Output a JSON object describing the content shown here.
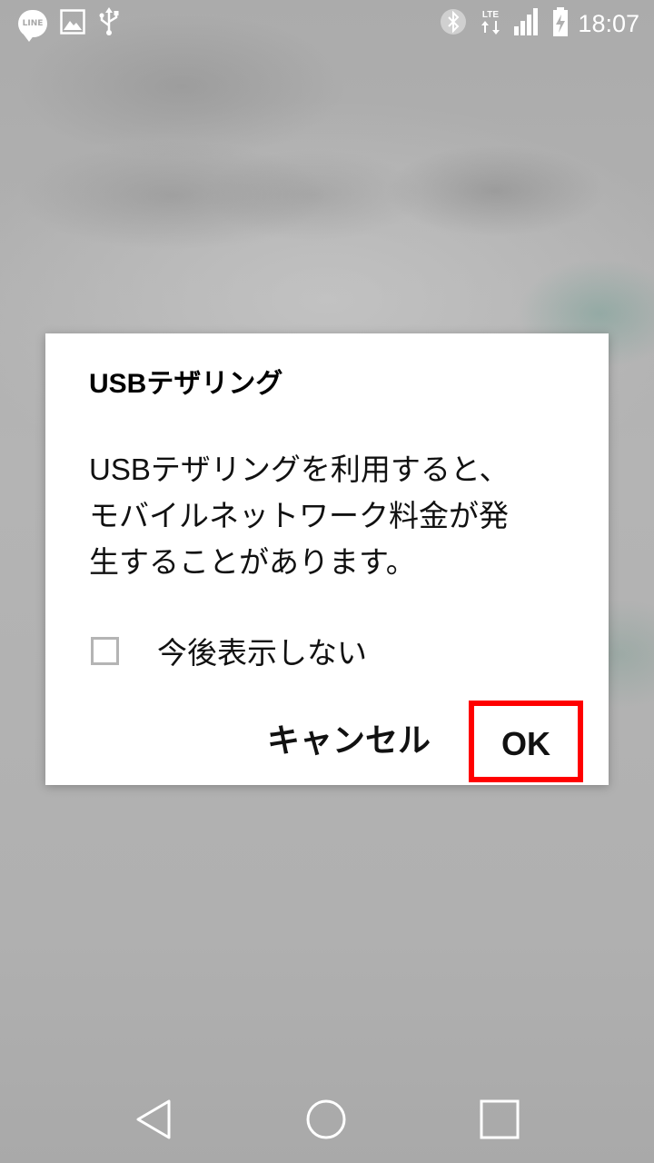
{
  "status_bar": {
    "icons": [
      "line-app-icon",
      "gallery-icon",
      "usb-icon",
      "bluetooth-icon",
      "lte-icon",
      "signal-icon",
      "battery-charging-icon"
    ],
    "line_label": "LINE",
    "lte_label": "LTE",
    "time": "18:07"
  },
  "dialog": {
    "title": "USBテザリング",
    "message_lines": [
      "USBテザリングを利用すると、",
      "モバイルネットワーク料金が発",
      "生することがあります。"
    ],
    "checkbox": {
      "label": "今後表示しない",
      "checked": false
    },
    "cancel_label": "キャンセル",
    "ok_label": "OK",
    "highlight_color": "#ff0000"
  },
  "nav_bar": {
    "icons": [
      "back-icon",
      "home-icon",
      "recent-apps-icon"
    ]
  }
}
